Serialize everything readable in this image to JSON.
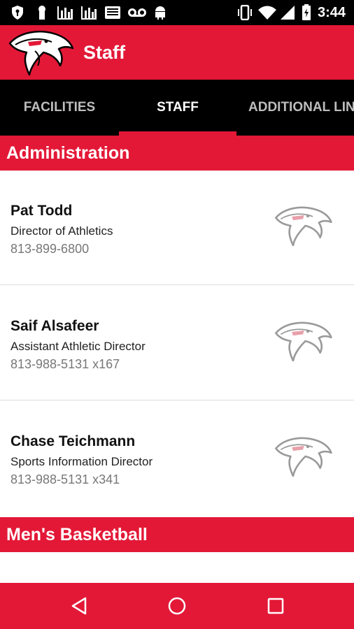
{
  "status_bar": {
    "time": "3:44",
    "icons": [
      "shield-icon",
      "keyhole-icon",
      "chart-icon",
      "chart-icon",
      "keyboard-icon",
      "voicemail-icon",
      "android-icon",
      "vibrate-icon",
      "wifi-icon",
      "signal-icon",
      "battery-icon"
    ]
  },
  "app_bar": {
    "title": "Staff",
    "logo": "hawk-logo-icon"
  },
  "tabs": [
    {
      "label": "FACILITIES",
      "selected": false
    },
    {
      "label": "STAFF",
      "selected": true
    },
    {
      "label": "ADDITIONAL LINKS",
      "selected": false
    }
  ],
  "sections": [
    {
      "title": "Administration",
      "staff": [
        {
          "name": "Pat Todd",
          "title": "Director of Athletics",
          "phone": "813-899-6800"
        },
        {
          "name": "Saif Alsafeer",
          "title": "Assistant Athletic Director",
          "phone": "813-988-5131 x167"
        },
        {
          "name": "Chase Teichmann",
          "title": "Sports Information Director",
          "phone": "813-988-5131 x341"
        }
      ]
    },
    {
      "title": "Men's Basketball",
      "staff": []
    }
  ],
  "nav_bar": {
    "buttons": [
      "back-icon",
      "home-icon",
      "recents-icon"
    ]
  },
  "colors": {
    "brand_red": "#e31837",
    "status_bar": "#000000",
    "tab_bar": "#000000",
    "tab_inactive": "#bdbdbd",
    "phone_gray": "#777777"
  }
}
